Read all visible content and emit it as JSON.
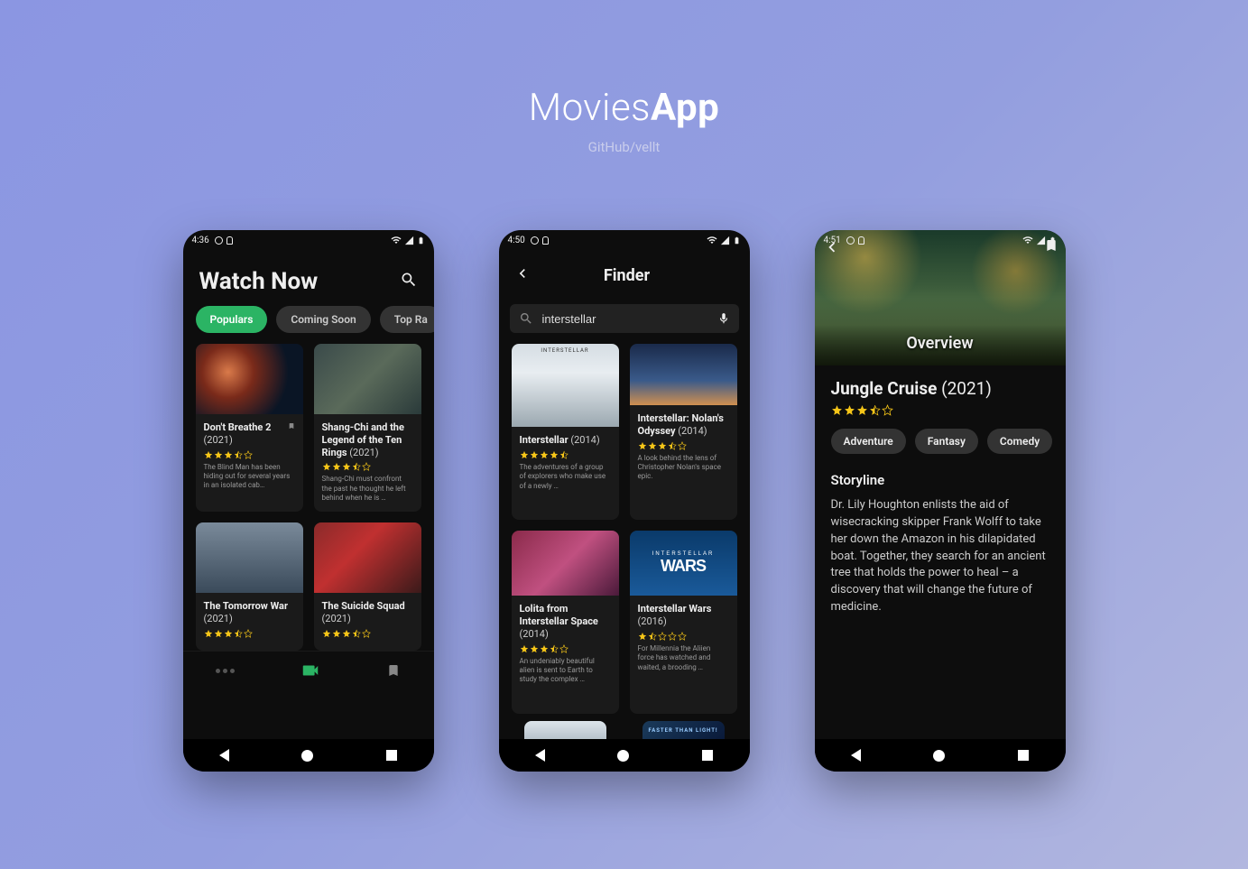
{
  "hero": {
    "title_light": "Movies",
    "title_bold": "App",
    "subtitle": "GitHub/vellt"
  },
  "screen1": {
    "status_time": "4:36",
    "header": "Watch Now",
    "chips": [
      "Populars",
      "Coming Soon",
      "Top Ra"
    ],
    "movies": [
      {
        "title": "Don't Breathe 2",
        "year": "(2021)",
        "rating": 3.5,
        "desc": "The Blind Man has been hiding out for several years in an isolated cab…"
      },
      {
        "title": "Shang-Chi and the Legend of the Ten Rings",
        "year": "(2021)",
        "rating": 3.5,
        "desc": "Shang-Chi must confront the past he thought he left behind when he is …"
      },
      {
        "title": "The Tomorrow War",
        "year": "(2021)",
        "rating": 3.5,
        "desc": ""
      },
      {
        "title": "The Suicide Squad",
        "year": "(2021)",
        "rating": 3.5,
        "desc": ""
      }
    ]
  },
  "screen2": {
    "status_time": "4:50",
    "header": "Finder",
    "search_value": "interstellar",
    "results": [
      {
        "title": "Interstellar",
        "year": "(2014)",
        "rating": 4.5,
        "desc": "The adventures of a group of explorers who make use of a newly …"
      },
      {
        "title": "Interstellar: Nolan's Odyssey",
        "year": "(2014)",
        "rating": 3.5,
        "desc": "A look behind the lens of Christopher Nolan's space epic."
      },
      {
        "title": "Lolita from Interstellar Space",
        "year": "(2014)",
        "rating": 3.5,
        "desc": "An undeniably beautiful alien is sent to Earth to study the complex …"
      },
      {
        "title": "Interstellar Wars",
        "year": "(2016)",
        "rating": 1.5,
        "desc": "For Millennia the Aliien force has watched and waited, a brooding …"
      }
    ],
    "teaser_text": "FASTER THAN LIGHT!"
  },
  "screen3": {
    "status_time": "4:51",
    "overview_label": "Overview",
    "title": "Jungle Cruise",
    "year": "(2021)",
    "rating": 3.5,
    "genres": [
      "Adventure",
      "Fantasy",
      "Comedy"
    ],
    "storyline_heading": "Storyline",
    "storyline": "Dr. Lily Houghton enlists the aid of wisecracking skipper Frank Wolff to take her down the Amazon in his dilapidated boat. Together, they search for an ancient tree that holds the power to heal – a discovery that will change the future of medicine."
  }
}
